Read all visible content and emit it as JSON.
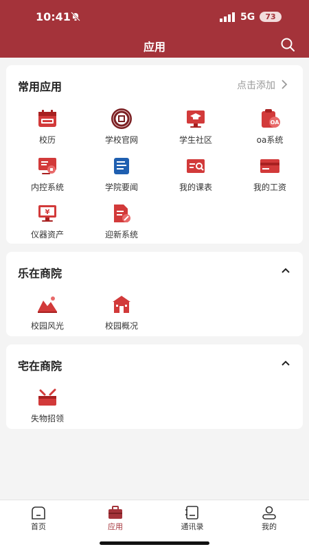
{
  "status": {
    "time": "10:41",
    "network": "5G",
    "battery": "73"
  },
  "nav": {
    "title": "应用"
  },
  "sections": [
    {
      "title": "常用应用",
      "action": "点击添加",
      "items": [
        {
          "label": "校历",
          "icon": "calendar-icon"
        },
        {
          "label": "学校官网",
          "icon": "school-emblem-icon"
        },
        {
          "label": "学生社区",
          "icon": "graduation-monitor-icon"
        },
        {
          "label": "oa系统",
          "icon": "oa-clipboard-icon"
        },
        {
          "label": "内控系统",
          "icon": "control-monitor-icon"
        },
        {
          "label": "学院要闻",
          "icon": "news-doc-icon"
        },
        {
          "label": "我的课表",
          "icon": "schedule-card-icon"
        },
        {
          "label": "我的工资",
          "icon": "salary-card-icon"
        },
        {
          "label": "仪器资产",
          "icon": "instrument-monitor-icon"
        },
        {
          "label": "迎新系统",
          "icon": "welcome-doc-icon"
        }
      ]
    },
    {
      "title": "乐在商院",
      "items": [
        {
          "label": "校园风光",
          "icon": "landscape-icon"
        },
        {
          "label": "校园概况",
          "icon": "building-icon"
        }
      ]
    },
    {
      "title": "宅在商院",
      "items": [
        {
          "label": "失物招领",
          "icon": "lost-found-box-icon"
        }
      ]
    }
  ],
  "tabbar": [
    {
      "label": "首页",
      "icon": "home-icon"
    },
    {
      "label": "应用",
      "icon": "briefcase-icon",
      "active": true
    },
    {
      "label": "通讯录",
      "icon": "contacts-icon"
    },
    {
      "label": "我的",
      "icon": "profile-icon"
    }
  ],
  "colors": {
    "brand": "#a4333a",
    "icon_red": "#d23a3a",
    "icon_blue": "#1f5fb0"
  }
}
